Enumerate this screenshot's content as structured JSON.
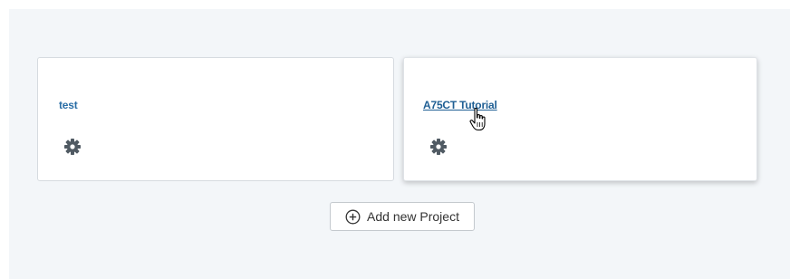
{
  "projects": [
    {
      "name": "test",
      "settings_icon": "gear-icon"
    },
    {
      "name": "A75CT Tutorial",
      "settings_icon": "gear-icon"
    }
  ],
  "add_button": {
    "label": "Add new Project",
    "icon": "circle-plus-icon"
  },
  "colors": {
    "background": "#f3f6f9",
    "card": "#ffffff",
    "link": "#2a6ea6",
    "icon": "#505a63"
  }
}
